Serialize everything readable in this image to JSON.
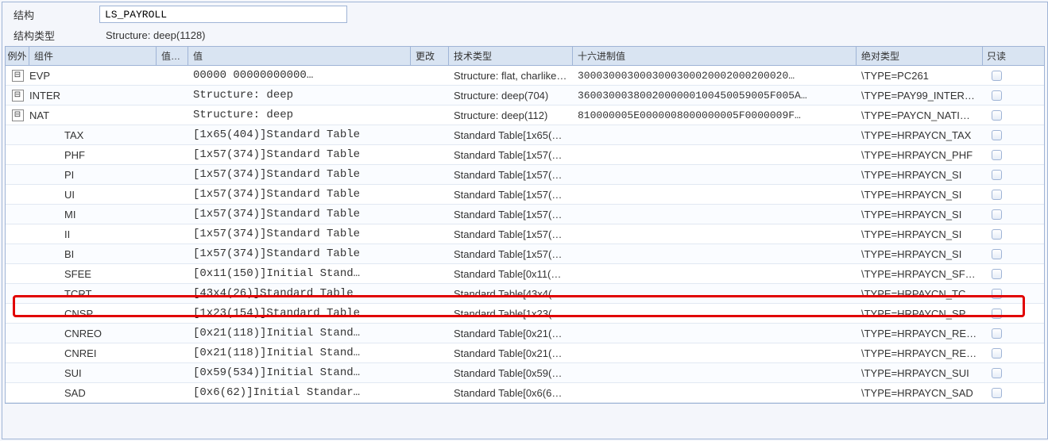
{
  "header": {
    "structure_label": "结构",
    "structure_value": "LS_PAYROLL",
    "structure_type_label": "结构类型",
    "structure_type_value": "Structure: deep(1128)"
  },
  "columns": {
    "exception": "例外",
    "component": "组件",
    "valshort": "值…",
    "value": "值",
    "change": "更改",
    "techtype": "技术类型",
    "hex": "十六进制值",
    "abstype": "绝对类型",
    "readonly": "只读"
  },
  "icons": {
    "collapse": "⊟"
  },
  "rows": [
    {
      "icon": true,
      "indent": 1,
      "component": "EVP",
      "value": "00000      00000000000…",
      "tech": "Structure: flat, charlike…",
      "hex": "3000300030003000300020002000200020…",
      "abs": "\\TYPE=PC261"
    },
    {
      "icon": true,
      "indent": 1,
      "component": "INTER",
      "value": "Structure: deep",
      "tech": "Structure: deep(704)",
      "hex": "3600300038002000000100450059005F005A…",
      "abs": "\\TYPE=PAY99_INTER…"
    },
    {
      "icon": true,
      "indent": 1,
      "component": "NAT",
      "value": "Structure: deep",
      "tech": "Structure: deep(112)",
      "hex": "810000005E0000008000000005F0000009F…",
      "abs": "\\TYPE=PAYCN_NATI…"
    },
    {
      "icon": false,
      "indent": 2,
      "component": "TAX",
      "value": "[1x65(404)]Standard Table",
      "tech": "Standard Table[1x65(…",
      "hex": "",
      "abs": "\\TYPE=HRPAYCN_TAX"
    },
    {
      "icon": false,
      "indent": 2,
      "component": "PHF",
      "value": "[1x57(374)]Standard Table",
      "tech": "Standard Table[1x57(…",
      "hex": "",
      "abs": "\\TYPE=HRPAYCN_PHF"
    },
    {
      "icon": false,
      "indent": 2,
      "component": "PI",
      "value": "[1x57(374)]Standard Table",
      "tech": "Standard Table[1x57(…",
      "hex": "",
      "abs": "\\TYPE=HRPAYCN_SI"
    },
    {
      "icon": false,
      "indent": 2,
      "component": "UI",
      "value": "[1x57(374)]Standard Table",
      "tech": "Standard Table[1x57(…",
      "hex": "",
      "abs": "\\TYPE=HRPAYCN_SI"
    },
    {
      "icon": false,
      "indent": 2,
      "component": "MI",
      "value": "[1x57(374)]Standard Table",
      "tech": "Standard Table[1x57(…",
      "hex": "",
      "abs": "\\TYPE=HRPAYCN_SI"
    },
    {
      "icon": false,
      "indent": 2,
      "component": "II",
      "value": "[1x57(374)]Standard Table",
      "tech": "Standard Table[1x57(…",
      "hex": "",
      "abs": "\\TYPE=HRPAYCN_SI"
    },
    {
      "icon": false,
      "indent": 2,
      "component": "BI",
      "value": "[1x57(374)]Standard Table",
      "tech": "Standard Table[1x57(…",
      "hex": "",
      "abs": "\\TYPE=HRPAYCN_SI"
    },
    {
      "icon": false,
      "indent": 2,
      "component": "SFEE",
      "value": "[0x11(150)]Initial Stand…",
      "tech": "Standard Table[0x11(…",
      "hex": "",
      "abs": "\\TYPE=HRPAYCN_SF…"
    },
    {
      "icon": false,
      "indent": 2,
      "component": "TCRT",
      "value": "[43x4(26)]Standard Table",
      "tech": "Standard Table[43x4(…",
      "hex": "",
      "abs": "\\TYPE=HRPAYCN_TC…"
    },
    {
      "icon": false,
      "indent": 2,
      "component": "CNSP",
      "value": "[1x23(154)]Standard Table",
      "tech": "Standard Table[1x23(…",
      "hex": "",
      "abs": "\\TYPE=HRPAYCN_SP"
    },
    {
      "icon": false,
      "indent": 2,
      "component": "CNREO",
      "value": "[0x21(118)]Initial Stand…",
      "tech": "Standard Table[0x21(…",
      "hex": "",
      "abs": "\\TYPE=HRPAYCN_RE…"
    },
    {
      "icon": false,
      "indent": 2,
      "component": "CNREI",
      "value": "[0x21(118)]Initial Stand…",
      "tech": "Standard Table[0x21(…",
      "hex": "",
      "abs": "\\TYPE=HRPAYCN_RE…"
    },
    {
      "icon": false,
      "indent": 2,
      "component": "SUI",
      "value": "[0x59(534)]Initial Stand…",
      "tech": "Standard Table[0x59(…",
      "hex": "",
      "abs": "\\TYPE=HRPAYCN_SUI"
    },
    {
      "icon": false,
      "indent": 2,
      "component": "SAD",
      "value": "[0x6(62)]Initial Standar…",
      "tech": "Standard Table[0x6(6…",
      "hex": "",
      "abs": "\\TYPE=HRPAYCN_SAD"
    }
  ]
}
